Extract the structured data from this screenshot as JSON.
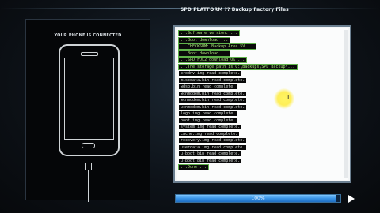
{
  "window": {
    "title": "SPD PLATFORM ?? Backup Factory Files"
  },
  "device_panel": {
    "caption": "YOUR PHONE IS CONNECTED"
  },
  "log": {
    "lines": [
      {
        "text": "...Software version: ...",
        "highlight": true
      },
      {
        "text": "...Boot download ...",
        "highlight": true
      },
      {
        "text": "...CHECKSUM: Backup Area 5V ...",
        "highlight": true
      },
      {
        "text": "...Boot download ...",
        "highlight": true
      },
      {
        "text": "...SPD FDL2 download OK ...",
        "highlight": true
      },
      {
        "text": "...The storage path is C:\\Backups\\SPD_Backup\\...",
        "highlight": true
      },
      {
        "text": "prodnv.img read complete.",
        "highlight": false
      },
      {
        "text": "miscdata.bin read complete.",
        "highlight": false
      },
      {
        "text": "wdsp.bin read complete.",
        "highlight": false
      },
      {
        "text": "wcnmodem.bin read complete.",
        "highlight": false
      },
      {
        "text": "wcnmodem.bin read complete.",
        "highlight": false
      },
      {
        "text": "wcnmodem.bin read complete.",
        "highlight": false
      },
      {
        "text": "logo.img read complete.",
        "highlight": false
      },
      {
        "text": "boot.img read complete.",
        "highlight": false
      },
      {
        "text": "system.img read complete.",
        "highlight": false
      },
      {
        "text": "cache.img read complete.",
        "highlight": false
      },
      {
        "text": "recovery.img read complete.",
        "highlight": false
      },
      {
        "text": "userdata.img read complete.",
        "highlight": false
      },
      {
        "text": "u-boot.bin read complete.",
        "highlight": false
      },
      {
        "text": "u-boot.bin read complete.",
        "highlight": false
      },
      {
        "text": "...Done ...",
        "highlight": true
      }
    ]
  },
  "progress": {
    "value": 0.97,
    "label": "100%"
  },
  "controls": {
    "play_icon": "play-icon"
  },
  "colors": {
    "log_text_bg": "#0a0a0a",
    "log_highlight_border": "#5fb34a",
    "progress_fill": "#3a94e6",
    "cursor_highlight": "#ffe83c"
  }
}
